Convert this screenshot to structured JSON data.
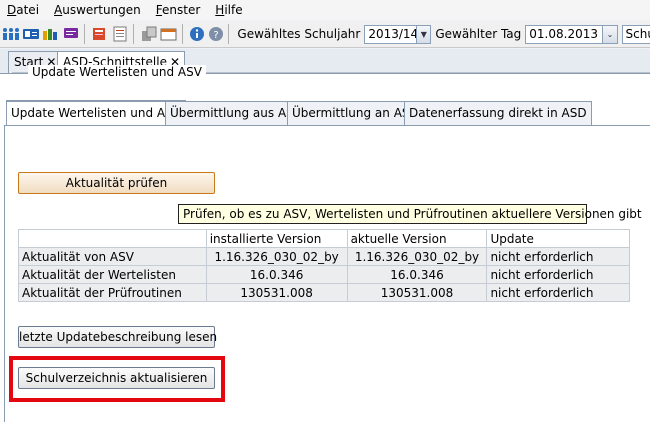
{
  "menu": [
    {
      "acc": "D",
      "rest": "atei"
    },
    {
      "acc": "A",
      "rest": "uswertungen"
    },
    {
      "acc": "F",
      "rest": "enster"
    },
    {
      "acc": "H",
      "rest": "ilfe"
    }
  ],
  "toolbar": {
    "schuljahr_label": "Gewähltes Schuljahr",
    "schuljahr_value": "2013/14",
    "tag_label": "Gewählter Tag",
    "tag_value": "01.08.2013",
    "cut_field_value": "Schu"
  },
  "outer_tabs": [
    {
      "label": "Start",
      "close": "✕"
    },
    {
      "label": "ASD-Schnittstelle",
      "close": "✕"
    }
  ],
  "inner_tabs": [
    "Update Wertelisten und ASV",
    "Übermittlung aus ASD",
    "Übermittlung an ASD",
    "Datenerfassung direkt in ASD"
  ],
  "group_title": "Update Wertelisten und ASV",
  "buttons": {
    "check": "Aktualität prüfen",
    "read_description": "letzte Updatebeschreibung lesen",
    "update_directory": "Schulverzeichnis aktualisieren"
  },
  "tooltip": "Prüfen, ob es zu ASV, Wertelisten und Prüfroutinen aktuellere Versionen gibt",
  "table": {
    "headers": [
      "",
      "installierte Version",
      "aktuelle Version",
      "Update"
    ],
    "rows": [
      [
        "Aktualität von ASV",
        "1.16.326_030_02_by",
        "1.16.326_030_02_by",
        "nicht erforderlich"
      ],
      [
        "Aktualität der Wertelisten",
        "16.0.346",
        "16.0.346",
        "nicht erforderlich"
      ],
      [
        "Aktualität der Prüfroutinen",
        "130531.008",
        "130531.008",
        "nicht erforderlich"
      ]
    ]
  },
  "colors": {
    "highlight": "#e3070f",
    "tooltip_bg": "#ffffe1"
  }
}
